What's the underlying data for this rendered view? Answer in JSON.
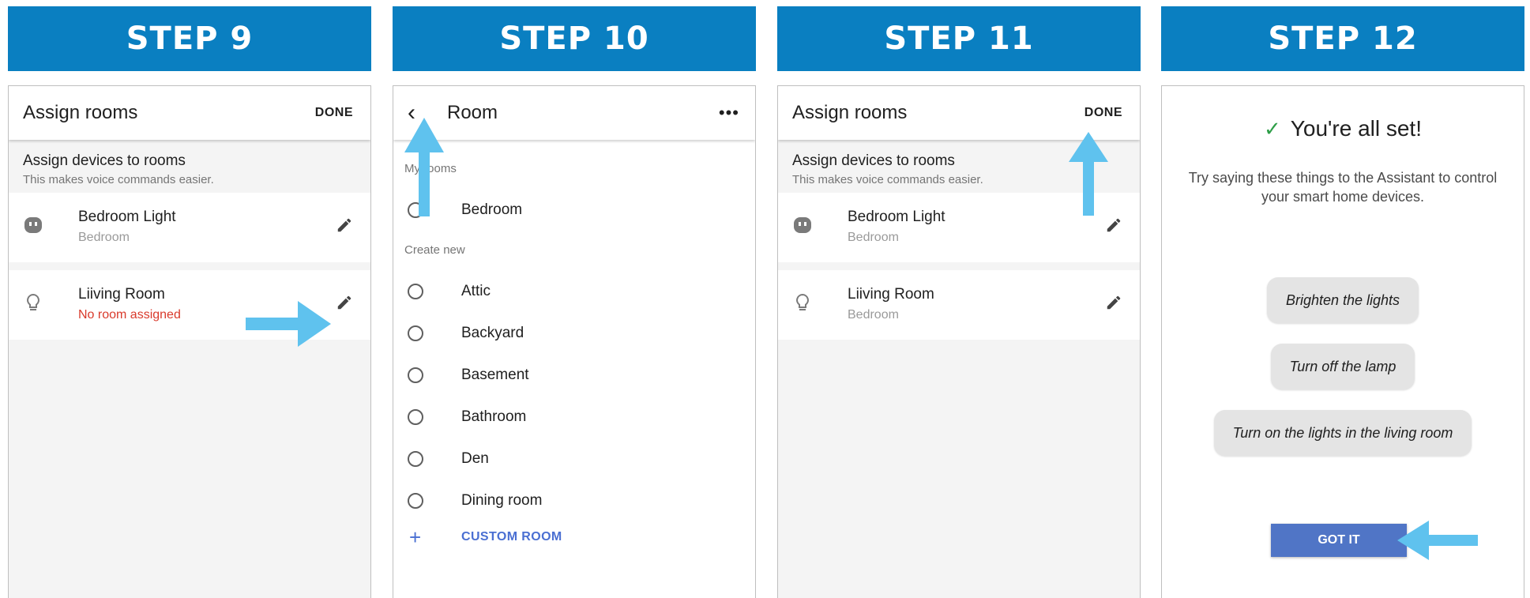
{
  "steps": [
    "STEP 9",
    "STEP 10",
    "STEP 11",
    "STEP 12"
  ],
  "assign": {
    "title": "Assign rooms",
    "done": "DONE",
    "section_title": "Assign devices to rooms",
    "section_sub": "This makes voice commands easier.",
    "step9_devices": [
      {
        "name": "Bedroom Light",
        "room": "Bedroom",
        "icon": "outlet-icon"
      },
      {
        "name": "Liiving Room",
        "room": "No room assigned",
        "icon": "bulb-icon"
      }
    ],
    "step11_devices": [
      {
        "name": "Bedroom Light",
        "room": "Bedroom",
        "icon": "outlet-icon"
      },
      {
        "name": "Liiving Room",
        "room": "Bedroom",
        "icon": "bulb-icon"
      }
    ]
  },
  "room_picker": {
    "title": "Room",
    "more": "•••",
    "my_rooms_label": "My rooms",
    "my_rooms": [
      "Bedroom"
    ],
    "create_new_label": "Create new",
    "new_rooms": [
      "Attic",
      "Backyard",
      "Basement",
      "Bathroom",
      "Den",
      "Dining room"
    ],
    "custom_room": "CUSTOM ROOM"
  },
  "all_set": {
    "title": "You're all set!",
    "subtitle": "Try saying these things to the Assistant to control your smart home devices.",
    "suggestions": [
      "Brighten the lights",
      "Turn off the lamp",
      "Turn on the lights in the living room"
    ],
    "button": "GOT IT"
  },
  "colors": {
    "header_blue": "#0a7fc1",
    "arrow_blue": "#5fc2ee",
    "warning_red": "#d93a2b",
    "link_blue": "#4a6fd2"
  }
}
